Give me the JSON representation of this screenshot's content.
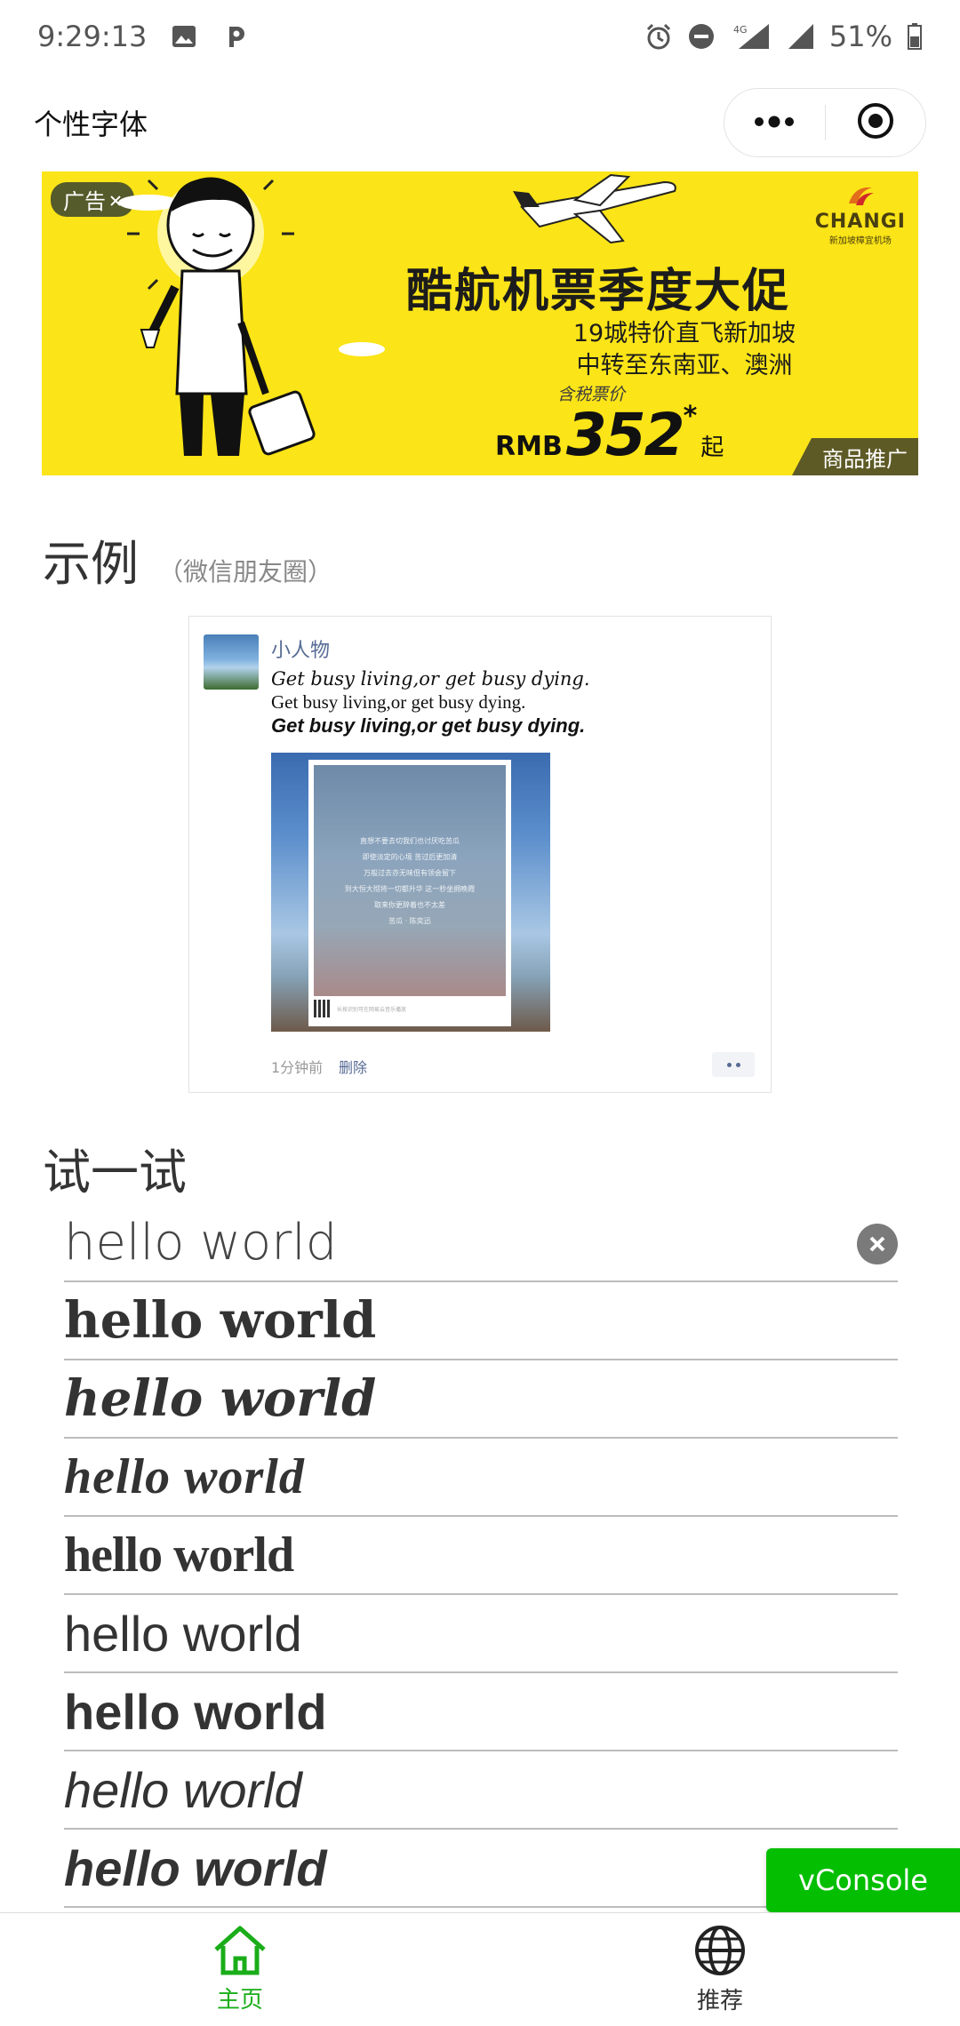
{
  "status_bar": {
    "time": "9:29:13",
    "network": "4G",
    "battery": "51%"
  },
  "navbar": {
    "title": "个性字体"
  },
  "ad": {
    "tag": "广告",
    "brand": "CHANGI",
    "brand_sub": "新加坡樟宜机场",
    "headline": "酷航机票季度大促",
    "line1": "19城特价直飞新加坡",
    "line2": "中转至东南亚、澳洲",
    "price_label": "含税票价",
    "currency": "RMB",
    "price": "352",
    "price_star": "*",
    "price_suffix": "起",
    "corner_label": "商品推广"
  },
  "example": {
    "title": "示例",
    "subtitle": "（微信朋友圈）",
    "post": {
      "user_name": "小人物",
      "text_lines": [
        "Get busy living,or get busy dying.",
        "Get busy living,or get busy dying.",
        "Get busy living,or get busy dying."
      ],
      "image_lines": [
        "直想不要去切我们也讨厌吃苦瓜",
        "即使淡定的心境 苦过后更加清",
        "万般过去亦无味但有领会留下",
        "到大恒大彻将一切都升华 这一秒坐拥晚霞",
        "取来你更辞着也不太差",
        "苦瓜 · 陈奕迅"
      ],
      "image_footer": "长按识别可在网易云音乐播放",
      "time": "1分钟前",
      "delete_label": "删除"
    }
  },
  "try": {
    "title": "试一试",
    "input_value": "hello world",
    "samples": [
      "hello world",
      "hello world",
      "hello world",
      "hello world",
      "hello world",
      "hello world",
      "hello world",
      "hello world"
    ]
  },
  "vconsole": {
    "label": "vConsole"
  },
  "tabbar": {
    "items": [
      {
        "label": "主页",
        "icon": "home-icon",
        "active": true
      },
      {
        "label": "推荐",
        "icon": "globe-icon",
        "active": false
      }
    ],
    "active_color": "#1aad19",
    "inactive_color": "#333333"
  }
}
